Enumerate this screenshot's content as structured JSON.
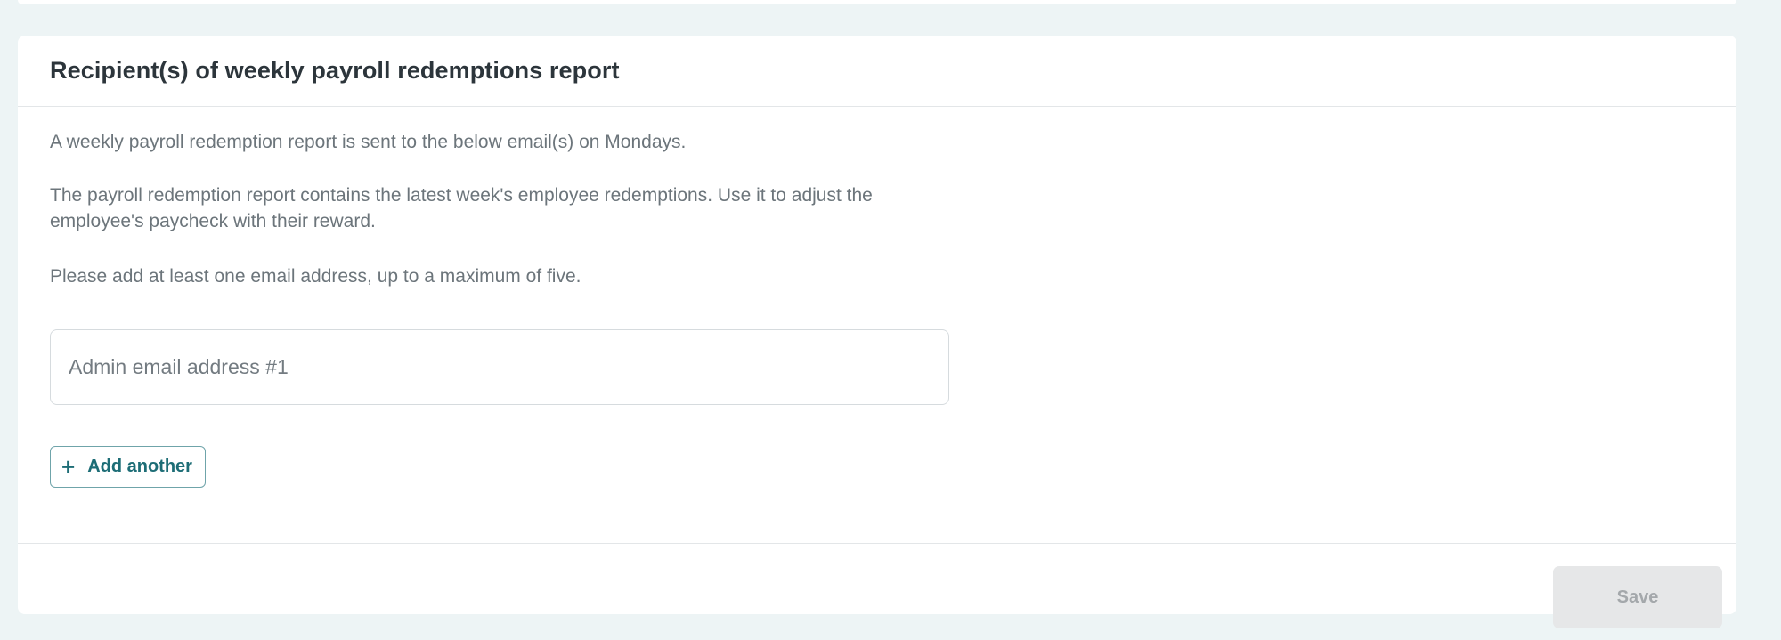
{
  "section": {
    "title": "Recipient(s) of weekly payroll redemptions report",
    "description_1": "A weekly payroll redemption report is sent to the below email(s) on Mondays.",
    "description_2": "The payroll redemption report contains the latest week's employee redemptions. Use it to adjust the employee's paycheck with their reward.",
    "description_3": "Please add at least one email address, up to a maximum of five."
  },
  "email_field": {
    "value": "",
    "placeholder": "Admin email address #1"
  },
  "add_another": {
    "icon": "plus-icon",
    "glyph": "+",
    "label": "Add another"
  },
  "footer": {
    "save_label": "Save",
    "save_disabled": true
  },
  "colors": {
    "page_background": "#edf4f5",
    "card_background": "#ffffff",
    "accent_teal": "#1d6d76",
    "disabled_button": "#e6e7e8"
  }
}
